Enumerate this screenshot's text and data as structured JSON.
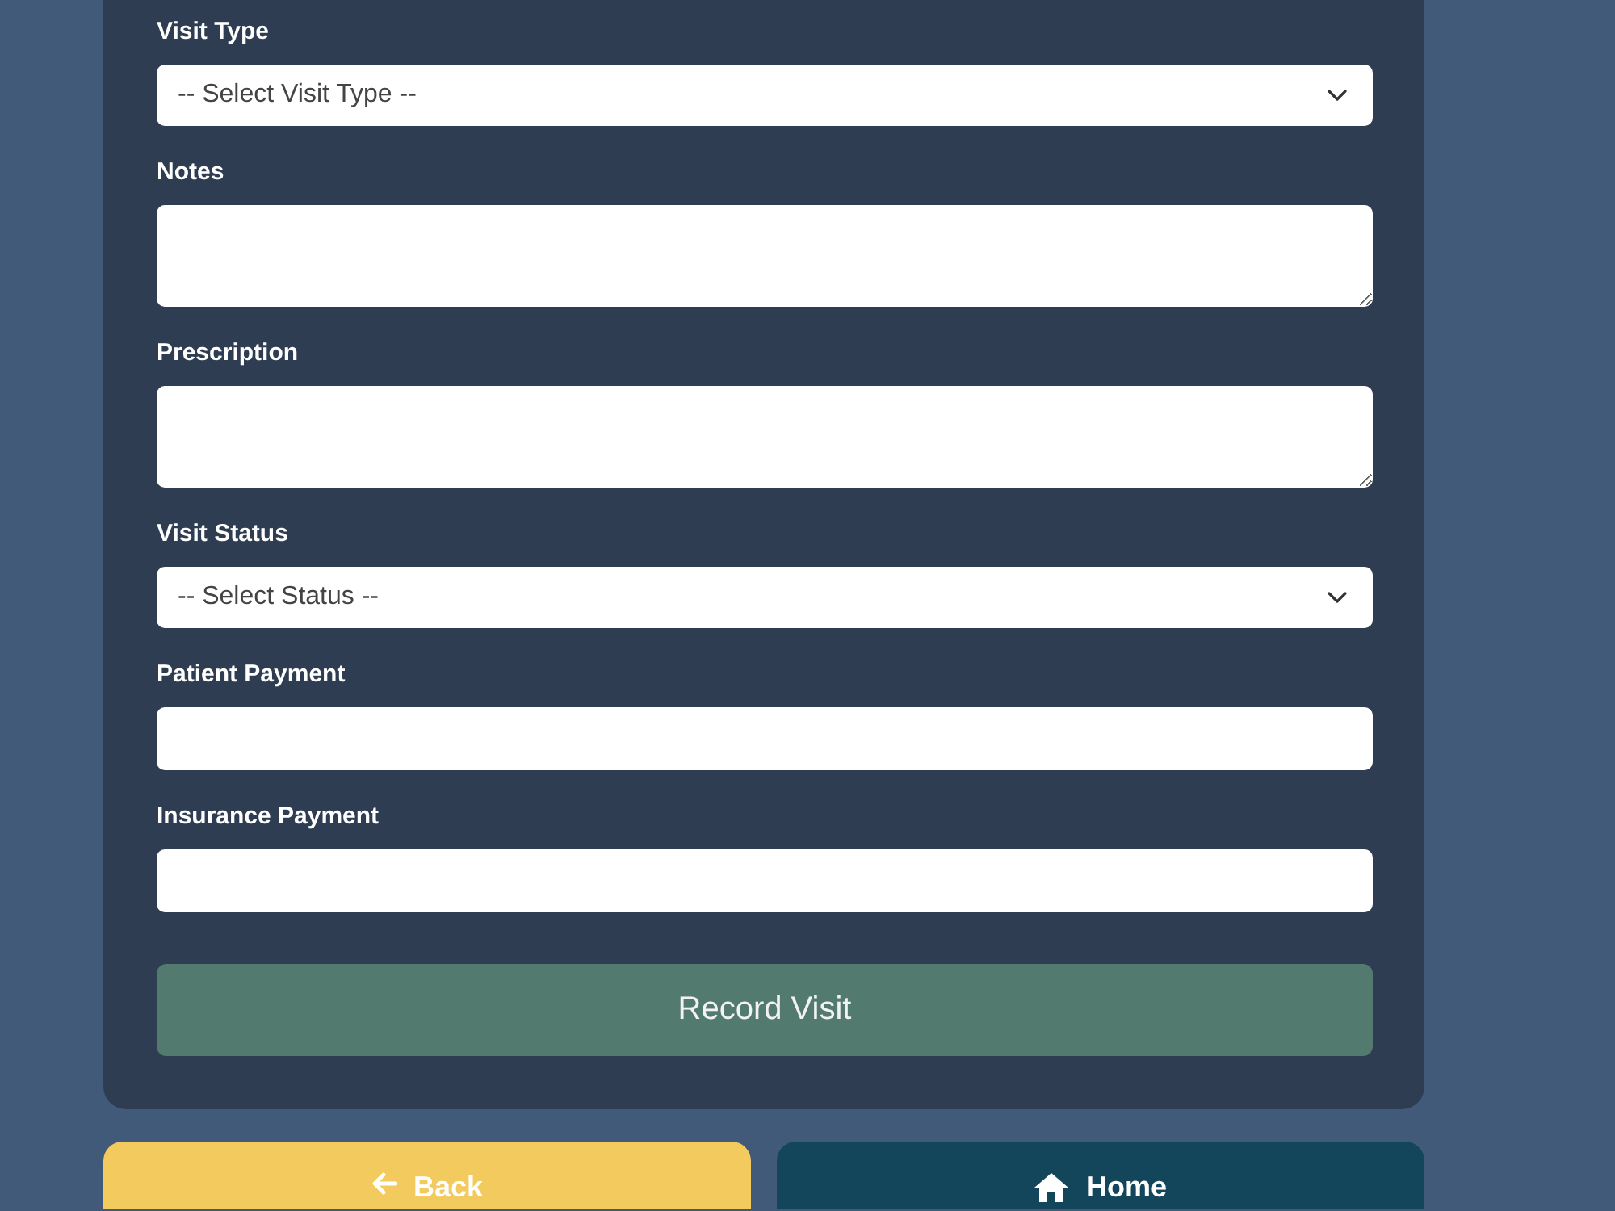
{
  "form": {
    "fields": [
      {
        "label": "Visit Type",
        "kind": "select",
        "value": "-- Select Visit Type --"
      },
      {
        "label": "Notes",
        "kind": "textarea"
      },
      {
        "label": "Prescription",
        "kind": "textarea"
      },
      {
        "label": "Visit Status",
        "kind": "select",
        "value": "-- Select Status --"
      },
      {
        "label": "Patient Payment",
        "kind": "input"
      },
      {
        "label": "Insurance Payment",
        "kind": "input"
      }
    ],
    "submit": "Record Visit"
  },
  "nav_buttons": [
    {
      "label": "Back",
      "kind": "back"
    },
    {
      "label": "Home",
      "kind": "home"
    }
  ]
}
